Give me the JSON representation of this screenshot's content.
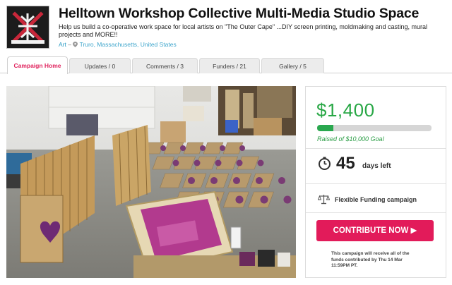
{
  "campaign": {
    "title": "Helltown Workshop Collective Multi-Media Studio Space",
    "description": "Help us build a co-operative work space for local artists on \"The Outer Cape\" ...DIY screen printing, moldmaking and casting, mural projects and MORE!!",
    "category": "Art",
    "category_separator": "–",
    "location": "Truro, Massachusetts, United States"
  },
  "tabs": [
    {
      "label": "Campaign Home",
      "active": true
    },
    {
      "label": "Updates / 0",
      "active": false
    },
    {
      "label": "Comments / 3",
      "active": false
    },
    {
      "label": "Funders / 21",
      "active": false
    },
    {
      "label": "Gallery / 5",
      "active": false
    }
  ],
  "funding": {
    "amount": "$1,400",
    "progress_fraction": 0.14,
    "raised_text": "Raised of $10,000 Goal",
    "days_number": "45",
    "days_label": "days left",
    "funding_type": "Flexible Funding campaign",
    "contribute_label": "CONTRIBUTE NOW ▶",
    "note": "This campaign will receive all of the funds contributed by Thu 14 Mar 11:59PM PT."
  },
  "colors": {
    "accent": "#e21b5a",
    "success": "#28a745",
    "link": "#2a9bc4"
  }
}
